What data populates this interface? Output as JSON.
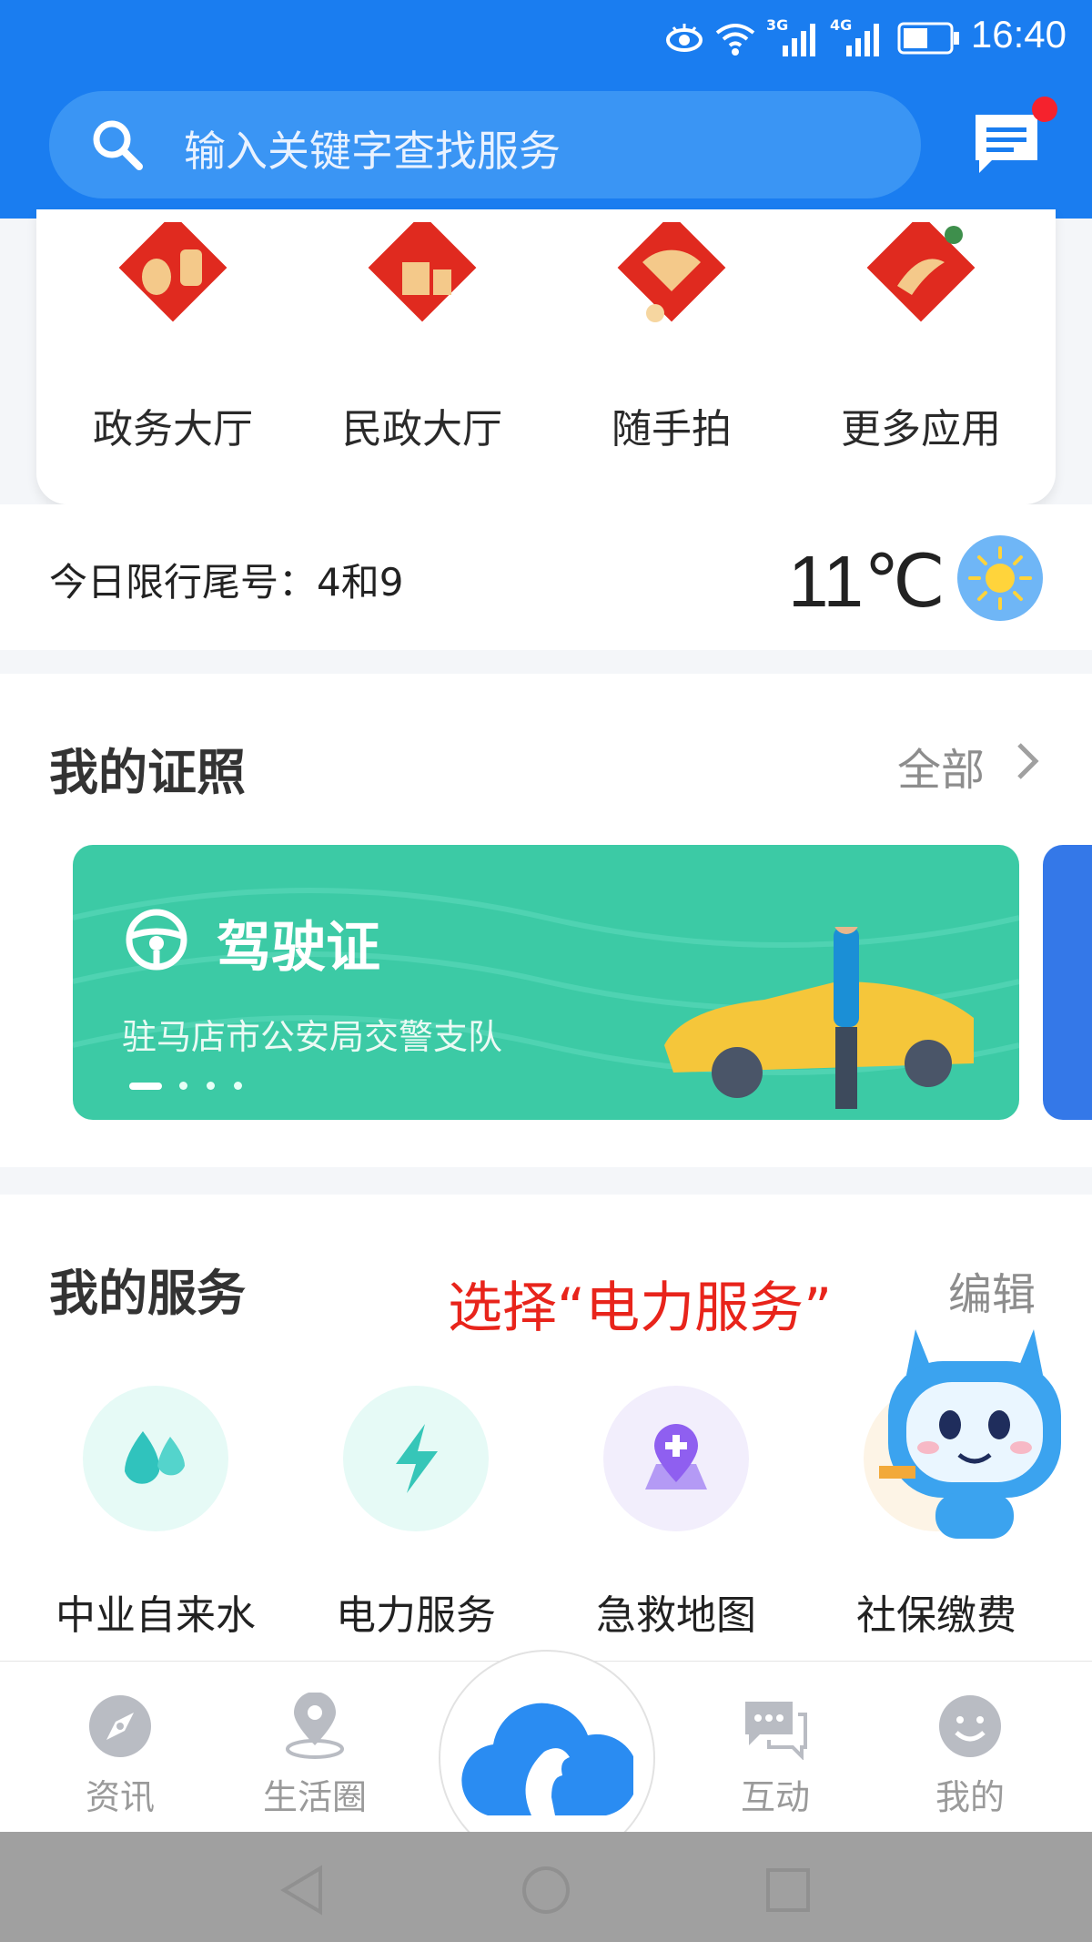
{
  "status_bar": {
    "time": "16:40",
    "signal_1": "3G",
    "signal_2": "4G"
  },
  "search": {
    "placeholder": "输入关键字查找服务"
  },
  "header": {
    "message_icon": "message-icon",
    "badge_color": "#f5222d"
  },
  "apps": [
    {
      "label": "政务大厅",
      "icon": "lantern-icon"
    },
    {
      "label": "民政大厅",
      "icon": "gift-icon"
    },
    {
      "label": "随手拍",
      "icon": "fan-icon"
    },
    {
      "label": "更多应用",
      "icon": "fish-icon"
    }
  ],
  "traffic": {
    "text": "今日限行尾号：4和9",
    "temperature": "11℃",
    "weather_icon": "sun-icon"
  },
  "certificates": {
    "title": "我的证照",
    "all_label": "全部",
    "card": {
      "name": "驾驶证",
      "issuer": "驻马店市公安局交警支队",
      "color": "#3ccaa5"
    }
  },
  "services": {
    "title": "我的服务",
    "edit_label": "编辑",
    "annotation": "选择“电力服务”",
    "items": [
      {
        "label": "中业自来水",
        "icon": "water-drop-icon",
        "color": "#3cc8c2"
      },
      {
        "label": "电力服务",
        "icon": "lightning-icon",
        "color": "#36c6b8"
      },
      {
        "label": "急救地图",
        "icon": "map-pin-icon",
        "color": "#9b6cf0"
      },
      {
        "label": "社保缴费",
        "icon": "wallet-icon",
        "color": "#f2a93a"
      }
    ]
  },
  "bottom_nav": [
    {
      "label": "资讯",
      "icon": "compass-icon"
    },
    {
      "label": "生活圈",
      "icon": "location-icon"
    },
    {
      "label": "",
      "icon": "cloud-horse-icon"
    },
    {
      "label": "互动",
      "icon": "chat-icon"
    },
    {
      "label": "我的",
      "icon": "smile-icon"
    }
  ]
}
